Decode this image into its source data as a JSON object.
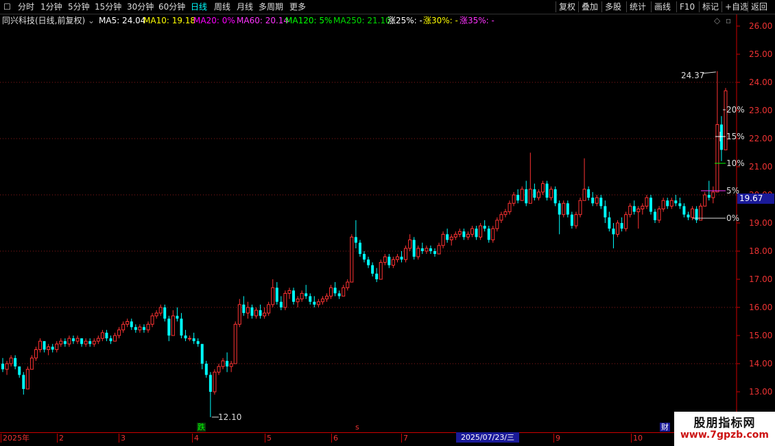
{
  "toolbar": {
    "left_items": [
      "分时",
      "1分钟",
      "5分钟",
      "15分钟",
      "30分钟",
      "60分钟",
      "日线",
      "周线",
      "月线",
      "多周期",
      "更多"
    ],
    "active": "日线",
    "right_items": [
      "复权",
      "叠加",
      "多股",
      "统计",
      "画线",
      "F10",
      "标记",
      "+自选",
      "返回"
    ]
  },
  "info": {
    "title": "同兴科技(日线,前复权)",
    "ma": [
      {
        "label": "MA5: 24.04",
        "color": "#ffffff"
      },
      {
        "label": "MA10: 19.18",
        "color": "#ffff00"
      },
      {
        "label": "MA20: 0%",
        "color": "#ff00ff"
      },
      {
        "label": "MA60: 20.14",
        "color": "#ff33ff"
      },
      {
        "label": "MA120: 5%",
        "color": "#00ff00"
      },
      {
        "label": "MA250: 21.10",
        "color": "#00dd00"
      },
      {
        "label": "涨25%: -",
        "color": "#ffffff"
      },
      {
        "label": "涨30%: -",
        "color": "#ffff00"
      },
      {
        "label": "涨35%: -",
        "color": "#ff33ff"
      }
    ]
  },
  "y_axis": {
    "labels": [
      "26.00",
      "25.00",
      "24.00",
      "23.00",
      "22.00",
      "21.00",
      "20.00",
      "19.00",
      "18.00",
      "17.00",
      "16.00",
      "15.00",
      "14.00",
      "13.00"
    ],
    "current_price": "19.67"
  },
  "annotations": {
    "high_label": "24.37",
    "low_label": "12.10",
    "pct_labels": [
      "20%",
      "15%",
      "10%",
      "5%",
      "0%"
    ],
    "die": "跌",
    "cai": "财",
    "s_mark": "s"
  },
  "time_axis": {
    "labels": [
      "2025年",
      "2",
      "3",
      "4",
      "5",
      "6",
      "7",
      "8",
      "9",
      "10"
    ],
    "cursor_date": "2025/07/23/三"
  },
  "watermark": {
    "title": "股朋指标网",
    "url": "www.7gpzb.com"
  },
  "colors": {
    "up": "#ff3333",
    "down": "#00ffff",
    "grid": "#8b1a1a",
    "axis": "#cc0000",
    "active_tab": "#00ffff"
  },
  "chart_data": {
    "type": "candlestick",
    "ylim": [
      12.6,
      26.4
    ],
    "candles": [
      [
        14.0,
        14.2,
        13.7,
        13.8
      ],
      [
        13.8,
        14.1,
        13.6,
        14.0
      ],
      [
        14.0,
        14.3,
        13.9,
        14.2
      ],
      [
        14.2,
        14.3,
        13.8,
        13.9
      ],
      [
        13.9,
        13.9,
        13.5,
        13.6
      ],
      [
        13.6,
        13.7,
        12.9,
        13.1
      ],
      [
        13.1,
        13.9,
        13.1,
        13.8
      ],
      [
        13.8,
        14.3,
        13.8,
        14.2
      ],
      [
        14.2,
        14.6,
        14.1,
        14.5
      ],
      [
        14.5,
        14.9,
        14.4,
        14.8
      ],
      [
        14.8,
        14.8,
        14.4,
        14.5
      ],
      [
        14.5,
        14.7,
        14.3,
        14.6
      ],
      [
        14.6,
        14.7,
        14.4,
        14.5
      ],
      [
        14.5,
        14.8,
        14.4,
        14.7
      ],
      [
        14.7,
        14.9,
        14.6,
        14.8
      ],
      [
        14.8,
        14.9,
        14.6,
        14.7
      ],
      [
        14.7,
        15.0,
        14.6,
        14.9
      ],
      [
        14.9,
        15.0,
        14.7,
        14.8
      ],
      [
        14.8,
        15.0,
        14.7,
        14.9
      ],
      [
        14.9,
        14.9,
        14.6,
        14.7
      ],
      [
        14.7,
        14.9,
        14.6,
        14.8
      ],
      [
        14.8,
        14.9,
        14.6,
        14.7
      ],
      [
        14.7,
        14.9,
        14.6,
        14.8
      ],
      [
        14.8,
        15.0,
        14.7,
        14.9
      ],
      [
        14.9,
        15.2,
        14.8,
        15.1
      ],
      [
        15.1,
        15.2,
        14.8,
        14.9
      ],
      [
        14.9,
        15.0,
        14.7,
        14.8
      ],
      [
        14.8,
        15.1,
        14.8,
        15.0
      ],
      [
        15.0,
        15.3,
        14.9,
        15.2
      ],
      [
        15.2,
        15.5,
        15.1,
        15.4
      ],
      [
        15.4,
        15.6,
        15.3,
        15.5
      ],
      [
        15.5,
        15.6,
        15.2,
        15.3
      ],
      [
        15.3,
        15.4,
        15.1,
        15.2
      ],
      [
        15.2,
        15.4,
        15.1,
        15.3
      ],
      [
        15.3,
        15.4,
        15.1,
        15.2
      ],
      [
        15.2,
        15.5,
        15.1,
        15.4
      ],
      [
        15.4,
        15.8,
        15.3,
        15.7
      ],
      [
        15.7,
        15.9,
        15.6,
        15.8
      ],
      [
        15.8,
        16.1,
        15.7,
        16.0
      ],
      [
        16.0,
        16.1,
        15.5,
        15.6
      ],
      [
        15.6,
        15.7,
        14.8,
        15.0
      ],
      [
        15.0,
        15.9,
        15.0,
        15.7
      ],
      [
        15.7,
        16.0,
        15.5,
        15.6
      ],
      [
        15.6,
        15.8,
        14.9,
        15.0
      ],
      [
        15.0,
        15.2,
        14.8,
        14.9
      ],
      [
        14.9,
        15.0,
        14.8,
        14.9
      ],
      [
        14.9,
        15.1,
        14.7,
        14.8
      ],
      [
        14.8,
        14.9,
        14.6,
        14.7
      ],
      [
        14.7,
        14.7,
        13.8,
        14.0
      ],
      [
        14.0,
        14.1,
        13.5,
        13.6
      ],
      [
        13.6,
        13.7,
        12.1,
        13.0
      ],
      [
        13.0,
        13.8,
        12.9,
        13.7
      ],
      [
        13.7,
        14.0,
        13.6,
        13.9
      ],
      [
        13.9,
        14.2,
        13.8,
        14.1
      ],
      [
        14.1,
        14.4,
        13.7,
        13.9
      ],
      [
        13.9,
        14.1,
        13.7,
        14.0
      ],
      [
        14.0,
        15.5,
        14.0,
        15.4
      ],
      [
        15.4,
        16.3,
        15.3,
        16.1
      ],
      [
        16.1,
        16.4,
        15.7,
        15.8
      ],
      [
        15.8,
        16.2,
        15.6,
        16.0
      ],
      [
        16.0,
        16.1,
        15.6,
        15.7
      ],
      [
        15.7,
        16.0,
        15.6,
        15.9
      ],
      [
        15.9,
        16.1,
        15.6,
        15.7
      ],
      [
        15.7,
        16.0,
        15.6,
        15.8
      ],
      [
        15.8,
        16.2,
        15.7,
        16.1
      ],
      [
        16.1,
        17.0,
        16.0,
        16.7
      ],
      [
        16.7,
        16.9,
        16.1,
        16.2
      ],
      [
        16.2,
        16.4,
        15.9,
        16.0
      ],
      [
        16.0,
        16.6,
        15.9,
        16.5
      ],
      [
        16.5,
        16.7,
        16.3,
        16.6
      ],
      [
        16.6,
        16.7,
        16.1,
        16.2
      ],
      [
        16.2,
        16.4,
        16.0,
        16.3
      ],
      [
        16.3,
        16.6,
        16.2,
        16.5
      ],
      [
        16.5,
        16.8,
        16.3,
        16.4
      ],
      [
        16.4,
        16.5,
        16.1,
        16.2
      ],
      [
        16.2,
        16.4,
        16.0,
        16.1
      ],
      [
        16.1,
        16.3,
        16.0,
        16.2
      ],
      [
        16.2,
        16.4,
        16.1,
        16.3
      ],
      [
        16.3,
        16.5,
        16.2,
        16.4
      ],
      [
        16.4,
        16.8,
        16.3,
        16.7
      ],
      [
        16.7,
        16.9,
        16.4,
        16.5
      ],
      [
        16.5,
        16.6,
        16.3,
        16.4
      ],
      [
        16.4,
        16.8,
        16.4,
        16.7
      ],
      [
        16.7,
        17.0,
        16.6,
        16.9
      ],
      [
        16.9,
        18.6,
        16.9,
        18.5
      ],
      [
        18.5,
        19.1,
        18.1,
        18.3
      ],
      [
        18.3,
        18.4,
        17.8,
        17.9
      ],
      [
        17.9,
        18.0,
        17.6,
        17.7
      ],
      [
        17.7,
        17.8,
        17.4,
        17.5
      ],
      [
        17.5,
        17.6,
        17.1,
        17.2
      ],
      [
        17.2,
        17.4,
        16.9,
        17.0
      ],
      [
        17.0,
        17.7,
        17.0,
        17.6
      ],
      [
        17.6,
        17.9,
        17.5,
        17.8
      ],
      [
        17.8,
        17.9,
        17.4,
        17.5
      ],
      [
        17.5,
        17.8,
        17.4,
        17.7
      ],
      [
        17.7,
        17.9,
        17.6,
        17.8
      ],
      [
        17.8,
        18.0,
        17.6,
        17.7
      ],
      [
        17.7,
        18.2,
        17.6,
        18.1
      ],
      [
        18.1,
        18.6,
        18.0,
        18.4
      ],
      [
        18.4,
        18.5,
        17.7,
        17.8
      ],
      [
        17.8,
        18.2,
        17.7,
        18.1
      ],
      [
        18.1,
        18.3,
        17.9,
        18.0
      ],
      [
        18.0,
        18.2,
        17.9,
        18.1
      ],
      [
        18.1,
        18.2,
        17.9,
        18.0
      ],
      [
        18.0,
        18.1,
        17.8,
        17.9
      ],
      [
        17.9,
        18.3,
        17.9,
        18.2
      ],
      [
        18.2,
        18.7,
        18.1,
        18.6
      ],
      [
        18.6,
        18.8,
        18.3,
        18.4
      ],
      [
        18.4,
        18.6,
        18.2,
        18.5
      ],
      [
        18.5,
        18.7,
        18.4,
        18.6
      ],
      [
        18.6,
        18.8,
        18.5,
        18.7
      ],
      [
        18.7,
        18.8,
        18.4,
        18.5
      ],
      [
        18.5,
        18.7,
        18.4,
        18.6
      ],
      [
        18.6,
        18.9,
        18.5,
        18.8
      ],
      [
        18.8,
        18.9,
        18.4,
        18.5
      ],
      [
        18.5,
        19.0,
        18.4,
        18.9
      ],
      [
        18.9,
        19.1,
        18.7,
        18.8
      ],
      [
        18.8,
        18.9,
        18.3,
        18.4
      ],
      [
        18.4,
        18.9,
        18.3,
        18.8
      ],
      [
        18.8,
        19.2,
        18.7,
        19.1
      ],
      [
        19.1,
        19.4,
        19.0,
        19.3
      ],
      [
        19.3,
        19.5,
        19.2,
        19.4
      ],
      [
        19.4,
        19.8,
        19.3,
        19.7
      ],
      [
        19.7,
        20.1,
        19.6,
        20.0
      ],
      [
        20.0,
        20.2,
        19.7,
        19.8
      ],
      [
        19.8,
        20.3,
        19.8,
        20.2
      ],
      [
        20.2,
        20.5,
        19.6,
        19.7
      ],
      [
        19.7,
        21.5,
        19.7,
        20.2
      ],
      [
        20.2,
        20.4,
        19.8,
        19.9
      ],
      [
        19.9,
        20.2,
        19.8,
        20.1
      ],
      [
        20.1,
        20.5,
        20.0,
        20.4
      ],
      [
        20.4,
        20.5,
        19.8,
        19.9
      ],
      [
        19.9,
        20.3,
        19.8,
        20.2
      ],
      [
        20.2,
        20.3,
        19.6,
        19.7
      ],
      [
        19.7,
        19.8,
        18.6,
        19.3
      ],
      [
        19.3,
        19.8,
        19.2,
        19.7
      ],
      [
        19.7,
        19.8,
        19.2,
        19.3
      ],
      [
        19.3,
        19.4,
        18.8,
        18.9
      ],
      [
        18.9,
        19.4,
        18.8,
        19.3
      ],
      [
        19.3,
        19.9,
        19.2,
        19.8
      ],
      [
        19.8,
        21.3,
        19.8,
        20.2
      ],
      [
        20.2,
        20.3,
        19.8,
        19.9
      ],
      [
        19.9,
        20.1,
        19.6,
        19.7
      ],
      [
        19.7,
        20.0,
        19.6,
        19.9
      ],
      [
        19.9,
        20.0,
        19.5,
        19.6
      ],
      [
        19.6,
        19.8,
        19.0,
        19.2
      ],
      [
        19.2,
        19.4,
        18.7,
        18.8
      ],
      [
        18.8,
        19.0,
        18.1,
        18.6
      ],
      [
        18.6,
        19.1,
        18.5,
        19.0
      ],
      [
        19.0,
        19.2,
        18.7,
        18.8
      ],
      [
        18.8,
        19.4,
        18.7,
        19.3
      ],
      [
        19.3,
        19.7,
        19.2,
        19.6
      ],
      [
        19.6,
        19.8,
        19.3,
        19.4
      ],
      [
        19.4,
        19.6,
        18.8,
        19.5
      ],
      [
        19.5,
        19.7,
        19.3,
        19.6
      ],
      [
        19.6,
        20.0,
        19.5,
        19.9
      ],
      [
        19.9,
        20.0,
        19.3,
        19.4
      ],
      [
        19.4,
        19.5,
        19.0,
        19.1
      ],
      [
        19.1,
        19.6,
        19.0,
        19.5
      ],
      [
        19.5,
        19.9,
        19.4,
        19.8
      ],
      [
        19.8,
        19.9,
        19.5,
        19.6
      ],
      [
        19.6,
        19.9,
        19.5,
        19.8
      ],
      [
        19.8,
        20.0,
        19.6,
        19.7
      ],
      [
        19.7,
        19.9,
        19.5,
        19.6
      ],
      [
        19.6,
        19.7,
        19.2,
        19.3
      ],
      [
        19.3,
        19.4,
        19.1,
        19.2
      ],
      [
        19.2,
        19.6,
        19.1,
        19.5
      ],
      [
        19.5,
        19.6,
        19.0,
        19.1
      ],
      [
        19.1,
        19.7,
        19.1,
        19.6
      ],
      [
        19.6,
        20.1,
        19.6,
        20.0
      ],
      [
        20.0,
        20.5,
        19.8,
        19.9
      ],
      [
        19.9,
        20.3,
        19.7,
        20.1
      ],
      [
        20.1,
        24.4,
        20.1,
        22.5
      ],
      [
        22.5,
        22.8,
        21.2,
        21.6
      ],
      [
        21.6,
        23.8,
        21.6,
        23.7
      ]
    ]
  }
}
